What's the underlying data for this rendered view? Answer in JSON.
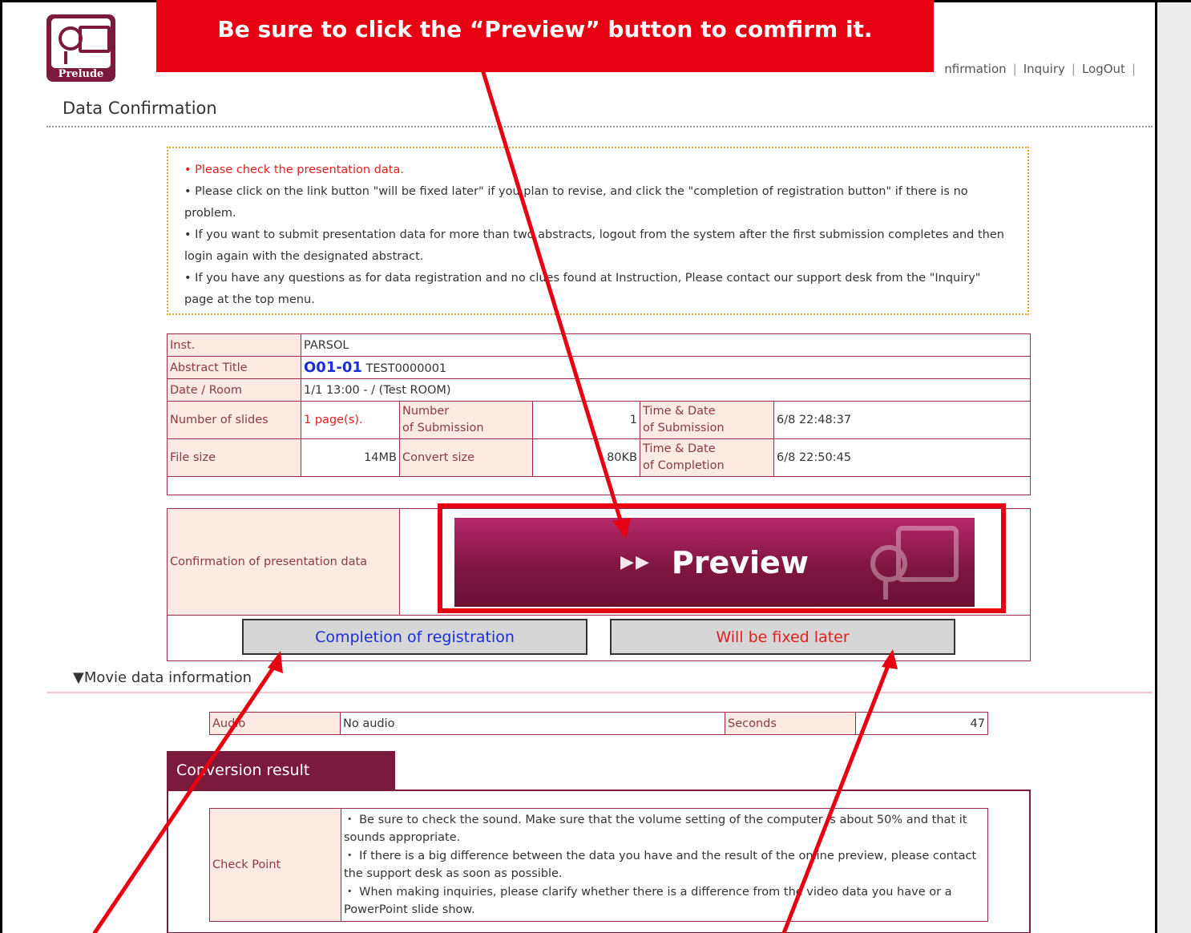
{
  "logo": {
    "text": "Prelude"
  },
  "nav": {
    "items": [
      "nfirmation",
      "Inquiry",
      "LogOut"
    ]
  },
  "page_title": "Data Confirmation",
  "notice": {
    "line1": "•  Please check the presentation data.",
    "line2": "•  Please click on the link button \"will be fixed later\" if you plan to revise, and click the \"completion of registration button\" if there is no problem.",
    "line3": "•  If you want to submit presentation data for more than two abstracts, logout from the system after the first submission completes and then login again with the designated abstract.",
    "line4": "•  If you have any questions as for data registration and no clues found at Instruction, Please contact our support desk from the \"Inquiry\" page at the top menu."
  },
  "info": {
    "inst_label": "Inst.",
    "inst_value": "PARSOL",
    "abstract_label": "Abstract Title",
    "abstract_code": "O01-01",
    "abstract_title": "TEST0000001",
    "date_label": "Date / Room",
    "date_value": "1/1 13:00 - / (Test ROOM)",
    "slides_label": "Number of slides",
    "slides_value": "1 page(s).",
    "submission_num_label_1": "Number",
    "submission_num_label_2": "of Submission",
    "submission_num_value": "1",
    "submission_time_label_1": "Time & Date",
    "submission_time_label_2": "of Submission",
    "submission_time_value": "6/8 22:48:37",
    "filesize_label": "File size",
    "filesize_value": "14MB",
    "convert_label": "Convert size",
    "convert_value": "80KB",
    "completion_time_label_1": "Time & Date",
    "completion_time_label_2": "of Completion",
    "completion_time_value": "6/8 22:50:45"
  },
  "preview": {
    "label": "Confirmation of presentation data",
    "arrows": "▶▶",
    "button": "Preview"
  },
  "actions": {
    "complete": "Completion of registration",
    "fix": "Will be fixed later"
  },
  "movie": {
    "heading": "▼Movie data information",
    "audio_label": "Audio",
    "audio_value": "No audio",
    "seconds_label": "Seconds",
    "seconds_value": "47"
  },
  "conversion": {
    "tab": "Conversion result",
    "check_label": "Check Point",
    "point1": "・ Be sure to check the sound. Make sure that the volume setting of the computer is about 50% and that it sounds appropriate.",
    "point2": "・ If there is a big difference between the data you have and the result of the online preview, please contact the support desk as soon as possible.",
    "point3": "・ When making inquiries, please clarify whether there is a difference from the video data you have or a PowerPoint slide show."
  },
  "annotation": {
    "banner": "Be sure to click the “Preview” button to comfirm it.",
    "color": "#e60012"
  },
  "colors": {
    "brand": "#7b1a3d",
    "label_bg": "#fdebe3",
    "link_blue": "#1c2fd6",
    "alert_red": "#e02020"
  }
}
